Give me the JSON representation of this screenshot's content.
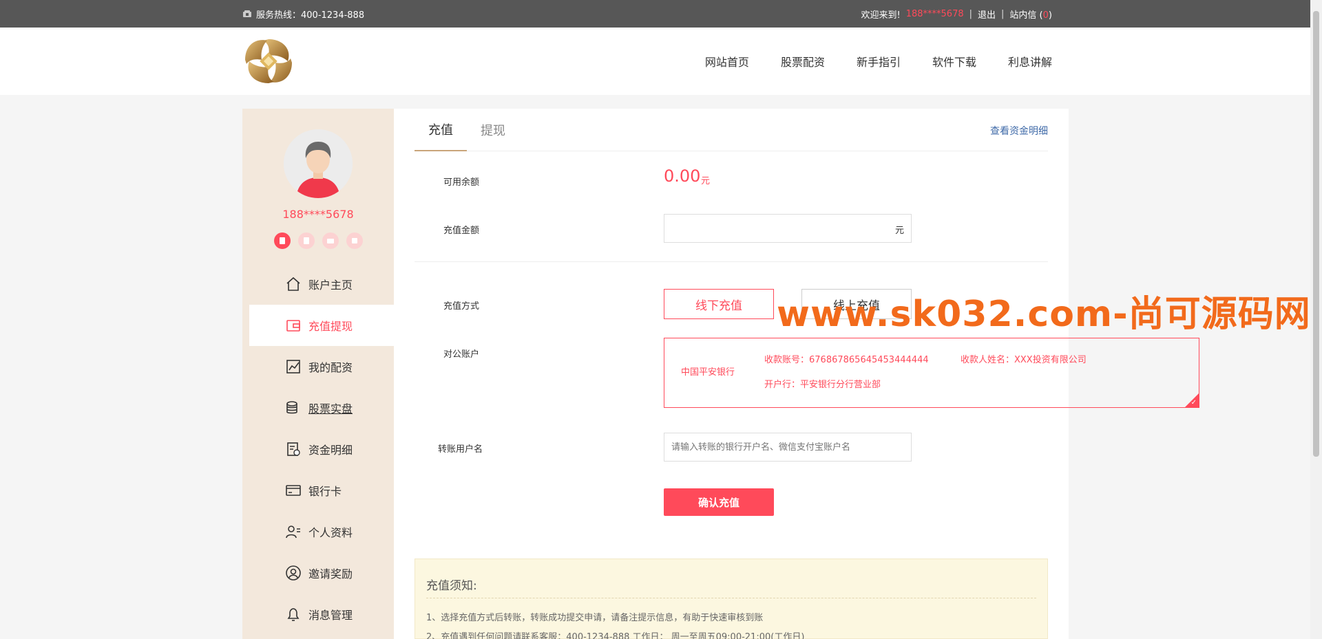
{
  "topbar": {
    "hotline_label": "服务热线：400-1234-888",
    "welcome": "欢迎来到!",
    "user": "188****5678",
    "logout": "退出",
    "messages_prefix": "站内信 (",
    "messages_count": "0",
    "messages_suffix": ")"
  },
  "nav": [
    "网站首页",
    "股票配资",
    "新手指引",
    "软件下载",
    "利息讲解"
  ],
  "sidebar": {
    "username": "188****5678",
    "menu": [
      {
        "label": "账户主页",
        "icon": "home-icon"
      },
      {
        "label": "充值提现",
        "icon": "wallet-icon"
      },
      {
        "label": "我的配资",
        "icon": "chart-icon"
      },
      {
        "label": "股票实盘",
        "icon": "coins-icon"
      },
      {
        "label": "资金明细",
        "icon": "ledger-icon"
      },
      {
        "label": "银行卡",
        "icon": "card-icon"
      },
      {
        "label": "个人资料",
        "icon": "profile-icon"
      },
      {
        "label": "邀请奖励",
        "icon": "user-circle-icon"
      },
      {
        "label": "消息管理",
        "icon": "bell-icon"
      }
    ]
  },
  "tabs": {
    "recharge": "充值",
    "withdraw": "提现",
    "detail_link": "查看资金明细"
  },
  "form": {
    "balance_label": "可用余额",
    "balance_value": "0.00",
    "balance_unit": "元",
    "amount_label": "充值金额",
    "amount_unit": "元",
    "method_label": "充值方式",
    "method_offline": "线下充值",
    "method_online": "线上充值",
    "account_label": "对公账户",
    "bank_name": "中国平安银行",
    "account_no": "收款账号：676867865645453444444",
    "payee": "收款人姓名：XXX投资有限公司",
    "branch": "开户行：平安银行分行营业部",
    "transfer_label": "转账用户名",
    "transfer_placeholder": "请输入转账的银行开户名、微信支付宝账户名",
    "confirm": "确认充值"
  },
  "notice": {
    "title": "充值须知:",
    "items": [
      "1、选择充值方式后转账，转账成功提交申请，请备注提示信息，有助于快速审核到账",
      "2、充值遇到任何问题请联系客服：400-1234-888 工作日： 周一至周五09:00-21:00(工作日)"
    ]
  },
  "watermark": "www.sk032.com-尚可源码网"
}
